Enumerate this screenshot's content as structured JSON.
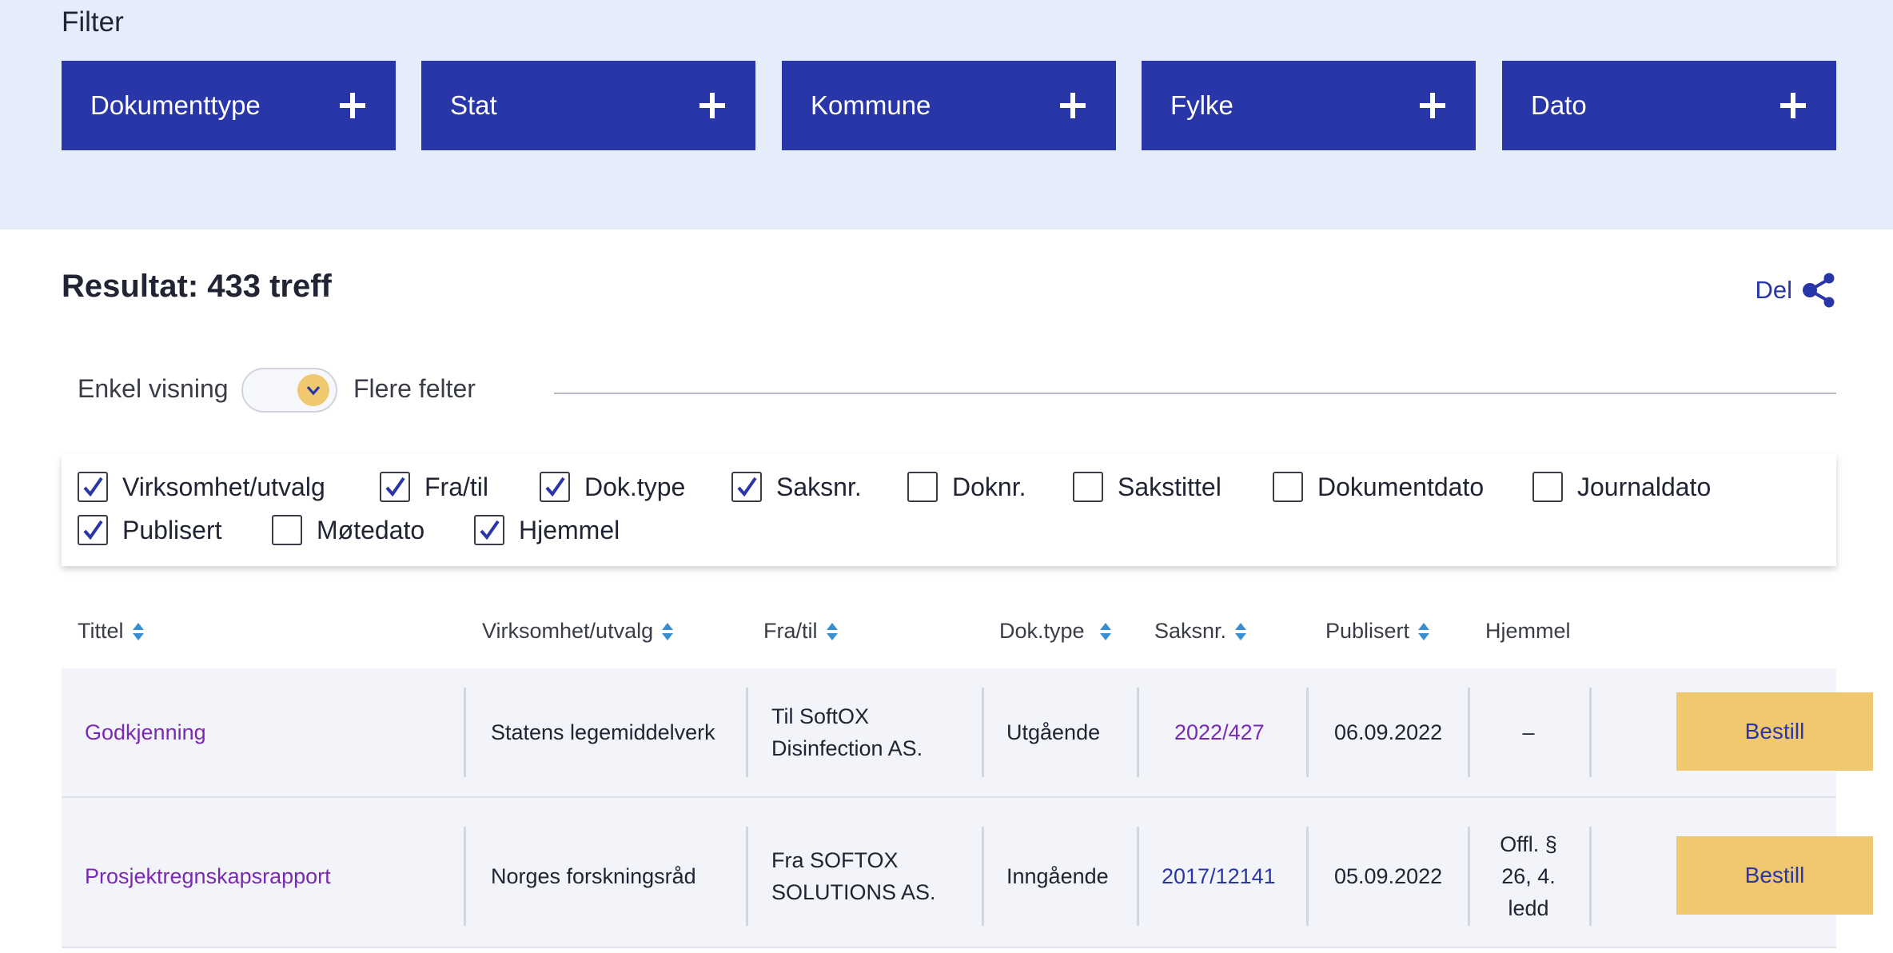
{
  "filter": {
    "heading": "Filter",
    "buttons": [
      {
        "label": "Dokumenttype"
      },
      {
        "label": "Stat"
      },
      {
        "label": "Kommune"
      },
      {
        "label": "Fylke"
      },
      {
        "label": "Dato"
      }
    ]
  },
  "result": {
    "title": "Resultat: 433 treff",
    "share_label": "Del"
  },
  "view": {
    "left_label": "Enkel visning",
    "right_label": "Flere felter"
  },
  "columns": [
    {
      "label": "Virksomhet/utvalg",
      "checked": true
    },
    {
      "label": "Fra/til",
      "checked": true
    },
    {
      "label": "Dok.type",
      "checked": true
    },
    {
      "label": "Saksnr.",
      "checked": true
    },
    {
      "label": "Doknr.",
      "checked": false
    },
    {
      "label": "Sakstittel",
      "checked": false
    },
    {
      "label": "Dokumentdato",
      "checked": false
    },
    {
      "label": "Journaldato",
      "checked": false
    },
    {
      "label": "Publisert",
      "checked": true
    },
    {
      "label": "Møtedato",
      "checked": false
    },
    {
      "label": "Hjemmel",
      "checked": true
    }
  ],
  "table": {
    "headers": [
      "Tittel",
      "Virksomhet/utvalg",
      "Fra/til",
      "Dok.type",
      "Saksnr.",
      "Publisert",
      "Hjemmel"
    ],
    "rows": [
      {
        "title": "Godkjenning",
        "agency": "Statens legemiddelverk",
        "from_to_1": "Til SoftOX",
        "from_to_2": "Disinfection AS.",
        "doc_type": "Utgående",
        "case_no": "2022/427",
        "published": "06.09.2022",
        "authority_1": "–",
        "authority_2": "",
        "authority_3": "",
        "action": "Bestill"
      },
      {
        "title": "Prosjektregnskapsrapport",
        "agency": "Norges forskningsråd",
        "from_to_1": "Fra SOFTOX",
        "from_to_2": "SOLUTIONS AS.",
        "doc_type": "Inngående",
        "case_no": "2017/12141",
        "published": "05.09.2022",
        "authority_1": "Offl. §",
        "authority_2": "26, 4.",
        "authority_3": "ledd",
        "action": "Bestill"
      }
    ]
  },
  "colors": {
    "primary": "#2936a8",
    "accent": "#f0c870",
    "band": "#e6edfa",
    "link": "#7a2ab0",
    "row_bg": "#f2f4fa"
  },
  "icons": {
    "plus": "plus-icon",
    "share": "share-icon",
    "chevron": "chevron-down-icon",
    "check": "checkmark-icon",
    "sort": "sort-icon"
  }
}
